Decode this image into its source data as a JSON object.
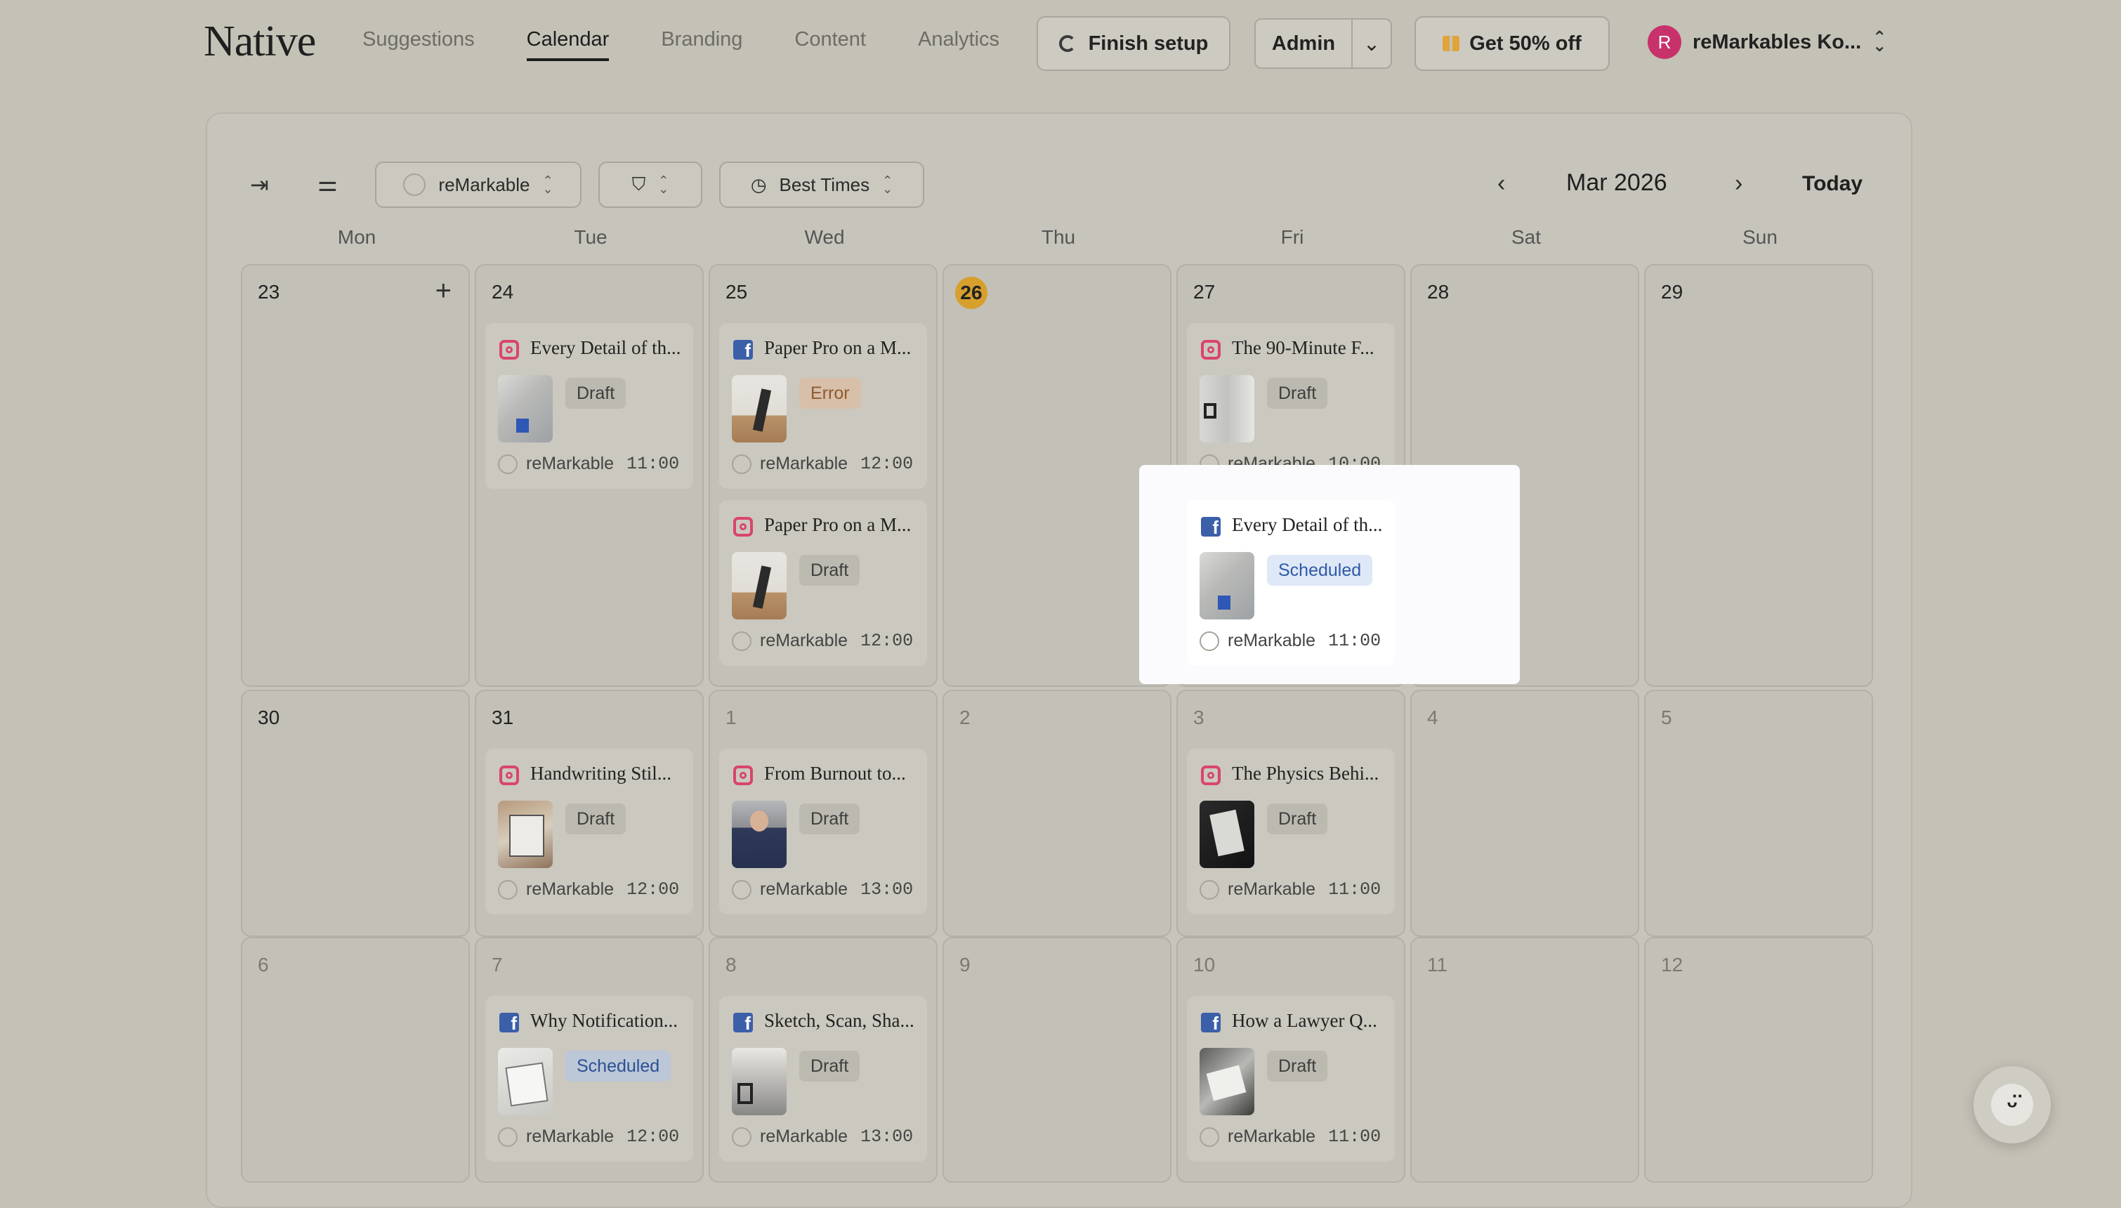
{
  "app": {
    "logo": "Native",
    "nav": [
      "Suggestions",
      "Calendar",
      "Branding",
      "Content",
      "Analytics"
    ],
    "active_nav": "Calendar",
    "finish_setup": "Finish setup",
    "admin": "Admin",
    "offer": "Get 50% off",
    "account_initial": "R",
    "account_name": "reMarkables Ko..."
  },
  "toolbar": {
    "profile_filter": "reMarkable",
    "best_times": "Best Times",
    "month": "Mar 2026",
    "today": "Today"
  },
  "weekdays": [
    "Mon",
    "Tue",
    "Wed",
    "Thu",
    "Fri",
    "Sat",
    "Sun"
  ],
  "weeks": [
    [
      "23",
      "24",
      "25",
      "26",
      "27",
      "28",
      "29"
    ],
    [
      "30",
      "31",
      "1",
      "2",
      "3",
      "4",
      "5"
    ],
    [
      "6",
      "7",
      "8",
      "9",
      "10",
      "11",
      "12"
    ]
  ],
  "today_date": "26",
  "posts": [
    {
      "title": "Every Detail of th...",
      "platform": "instagram",
      "status": "Draft",
      "account": "reMarkable",
      "time": "11:00"
    },
    {
      "title": "Paper Pro on a M...",
      "platform": "facebook",
      "status": "Error",
      "account": "reMarkable",
      "time": "12:00"
    },
    {
      "title": "Paper Pro on a M...",
      "platform": "instagram",
      "status": "Draft",
      "account": "reMarkable",
      "time": "12:00"
    },
    {
      "title": "The 90-Minute F...",
      "platform": "instagram",
      "status": "Draft",
      "account": "reMarkable",
      "time": "10:00"
    },
    {
      "title": "Every Detail of th...",
      "platform": "facebook",
      "status": "Scheduled",
      "account": "reMarkable",
      "time": "11:00"
    },
    {
      "title": "Handwriting Stil...",
      "platform": "instagram",
      "status": "Draft",
      "account": "reMarkable",
      "time": "12:00"
    },
    {
      "title": "From Burnout to...",
      "platform": "instagram",
      "status": "Draft",
      "account": "reMarkable",
      "time": "13:00"
    },
    {
      "title": "The Physics Behi...",
      "platform": "instagram",
      "status": "Draft",
      "account": "reMarkable",
      "time": "11:00"
    },
    {
      "title": "Why Notification...",
      "platform": "facebook",
      "status": "Scheduled",
      "account": "reMarkable",
      "time": "12:00"
    },
    {
      "title": "Sketch, Scan, Sha...",
      "platform": "facebook",
      "status": "Draft",
      "account": "reMarkable",
      "time": "13:00"
    },
    {
      "title": "How a Lawyer Q...",
      "platform": "facebook",
      "status": "Draft",
      "account": "reMarkable",
      "time": "11:00"
    }
  ],
  "icons": {
    "collapse": "collapse-sidebar-icon",
    "settings": "sliders-icon",
    "filter": "filter-icon",
    "clock": "clock-icon",
    "prev": "chevron-left-icon",
    "next": "chevron-right-icon",
    "add": "plus-icon",
    "help": "smiley-icon"
  },
  "colors": {
    "accent_today": "#d79f2c",
    "instagram": "#d9456b",
    "facebook": "#3b5fa8",
    "scheduled": "#2c5193",
    "error": "#8f5a2f"
  }
}
